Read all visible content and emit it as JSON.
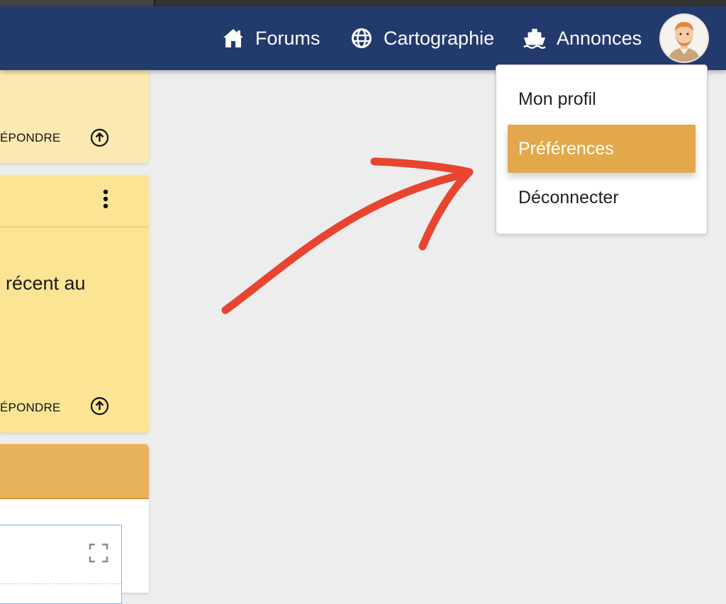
{
  "navbar": {
    "links": [
      {
        "label": "Forums",
        "icon": "home-icon"
      },
      {
        "label": "Cartographie",
        "icon": "globe-icon"
      },
      {
        "label": "Annonces",
        "icon": "ship-icon"
      }
    ],
    "avatar": "user-avatar"
  },
  "user_menu": {
    "items": [
      {
        "label": "Mon profil"
      },
      {
        "label": "Préférences",
        "highlighted": true
      },
      {
        "label": "Déconnecter"
      }
    ],
    "highlight_color": "#e2a84b"
  },
  "posts": {
    "reply_label": "ÉPONDRE",
    "card2_text": "récent au"
  },
  "colors": {
    "navbar": "#233a6d",
    "annotation_arrow": "#e8442f",
    "card_light": "#fce9b1",
    "card_yellow": "#fbe594",
    "card_orange": "#e8b35c"
  }
}
